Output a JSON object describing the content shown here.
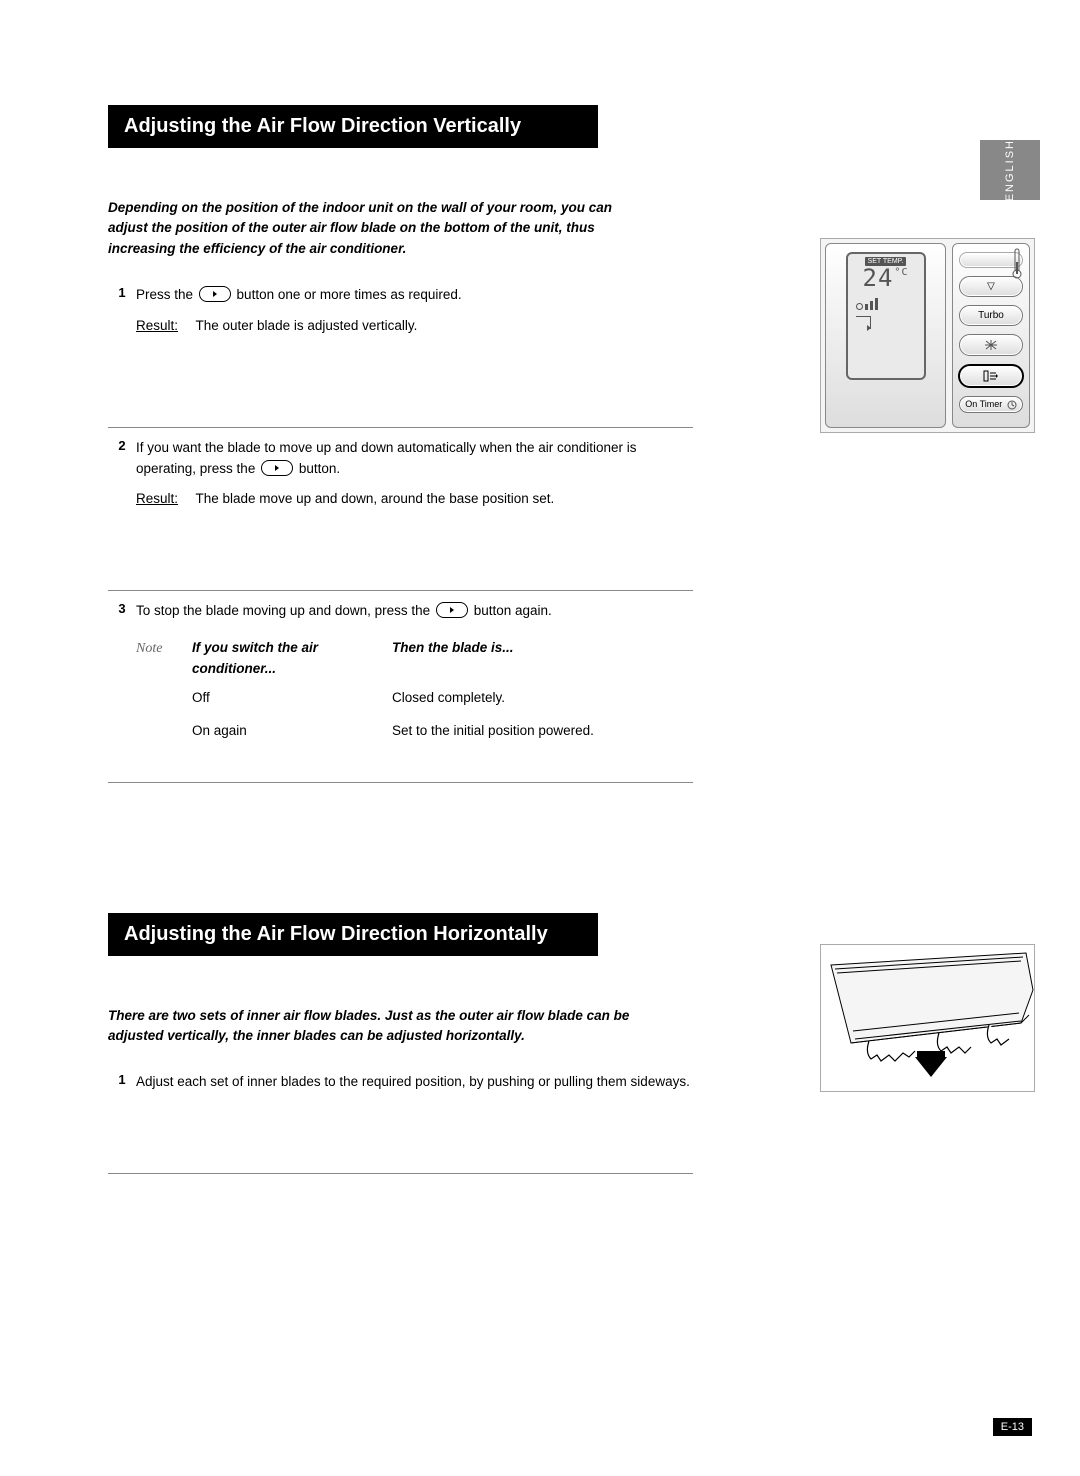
{
  "side_tab": "ENGLISH",
  "section1": {
    "title": "Adjusting the Air Flow Direction Vertically",
    "intro": "Depending on the position of the indoor unit on the wall of your room, you can adjust the position of the outer air flow blade on the bottom of the unit, thus increasing the efficiency of the air conditioner.",
    "steps": [
      {
        "num": "1",
        "text_a": "Press the ",
        "text_b": " button one or more times as required.",
        "result_label": "Result:",
        "result_text": "The outer blade is adjusted vertically."
      },
      {
        "num": "2",
        "text_a": "If you want the blade to move up and down automatically when the air conditioner is operating, press the ",
        "text_b": " button.",
        "result_label": "Result:",
        "result_text": "The blade move up and down, around the base position set."
      },
      {
        "num": "3",
        "text_a": "To stop the blade moving up and down, press the ",
        "text_b": " button again.",
        "note_label": "Note",
        "note_head_a": "If you switch the air conditioner...",
        "note_head_b": "Then the blade is...",
        "rows": [
          {
            "a": "Off",
            "b": "Closed completely."
          },
          {
            "a": "On again",
            "b": "Set to the initial position powered."
          }
        ]
      }
    ]
  },
  "remote": {
    "lcd_label": "SET TEMP.",
    "temp": "24",
    "temp_unit": "°C",
    "buttons": {
      "down": "▽",
      "turbo": "Turbo",
      "on_timer": "On Timer"
    }
  },
  "section2": {
    "title": "Adjusting the Air Flow Direction Horizontally",
    "intro": "There are two sets of inner air flow blades. Just as the outer air flow blade can be adjusted vertically, the inner blades can be adjusted horizontally.",
    "steps": [
      {
        "num": "1",
        "text": "Adjust each set of inner blades to the required position, by pushing or pulling them sideways."
      }
    ]
  },
  "page_number": "E-13"
}
